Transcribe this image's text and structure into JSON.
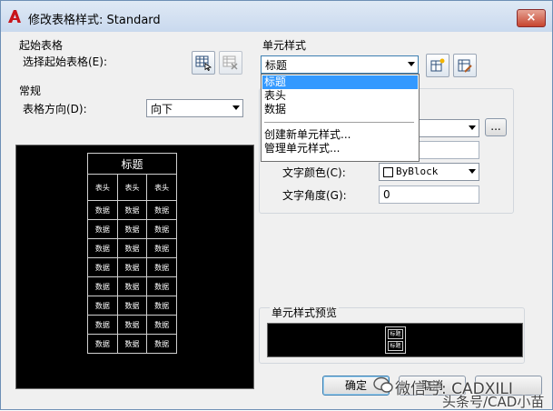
{
  "window": {
    "title": "修改表格样式: Standard",
    "close_label": "×"
  },
  "start_table": {
    "heading": "起始表格",
    "select_label": "选择起始表格(E):"
  },
  "general": {
    "heading": "常规",
    "direction_label": "表格方向(D):",
    "direction_value": "向下"
  },
  "table_preview": {
    "title": "标题",
    "header_cells": [
      "表头",
      "表头",
      "表头"
    ],
    "data_cell": "数据",
    "data_rows": 8
  },
  "cell_style": {
    "heading": "单元样式",
    "selected": "标题",
    "options": [
      "标题",
      "表头",
      "数据"
    ],
    "actions": [
      "创建新单元样式...",
      "管理单元样式..."
    ],
    "more_button": "..."
  },
  "text_props": {
    "color_label": "文字颜色(C):",
    "color_value": "ByBlock",
    "angle_label": "文字角度(G):",
    "angle_value": "0"
  },
  "cell_preview": {
    "heading": "单元样式预览",
    "cell_text": "标题"
  },
  "buttons": {
    "ok": "确定",
    "cancel": "取消"
  },
  "watermark": {
    "line1": "微信号: CADXILI",
    "line2": "头条号/CAD小苗"
  },
  "colors": {
    "highlight": "#3399ff",
    "preview_bg": "#000000"
  }
}
